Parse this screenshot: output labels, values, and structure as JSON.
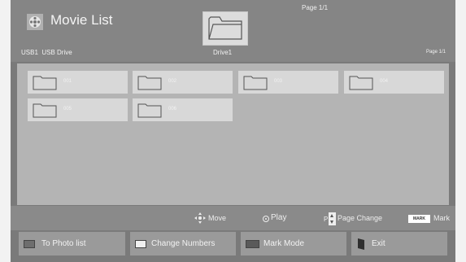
{
  "header": {
    "title": "Movie List",
    "page_indicator": "Page 1/1",
    "source": "USB1",
    "device": "USB Drive",
    "drive": "Drive1",
    "page_small": "Page 1/1"
  },
  "folders": [
    "001",
    "002",
    "003",
    "004",
    "005",
    "006"
  ],
  "hints": {
    "move": "Move",
    "play": "Play",
    "page_p": "P",
    "page_change": "Page Change",
    "mark_badge": "MARK",
    "mark": "Mark"
  },
  "buttons": {
    "to_photo_list": "To Photo list",
    "change_numbers": "Change Numbers",
    "mark_mode": "Mark Mode",
    "exit": "Exit"
  },
  "colors": {
    "red_swatch": "#6e6e6e",
    "green_swatch": "#f0f0f0",
    "yellow_swatch": "#5a5a5a",
    "blue_swatch": "#3a3a3a"
  },
  "icons": {
    "app": "movie-reel-icon",
    "move": "four-way-arrow-icon",
    "play": "ok-circle-icon",
    "page": "page-up-down-icon",
    "folder": "folder-icon"
  }
}
